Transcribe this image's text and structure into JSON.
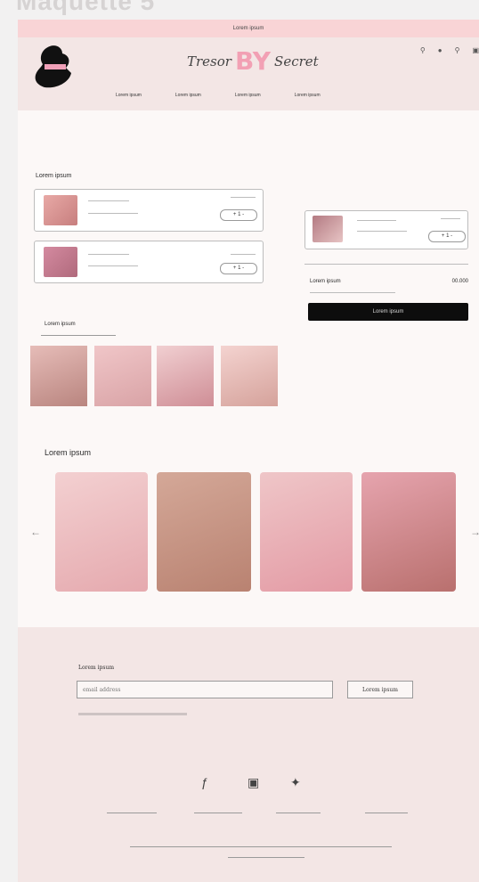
{
  "frame_title": "Maquette 5",
  "topbar": {
    "text": "Lorem ipsum"
  },
  "header": {
    "brand_left": "Tresor",
    "brand_mid": "BY",
    "brand_right": "Secret",
    "nav": [
      "Lorem ipsum",
      "Lorem ipsum",
      "Lorem ipsum",
      "Lorem ipsum"
    ]
  },
  "cart": {
    "title": "Lorem ipsum",
    "items": [
      {
        "qty": "+ 1 -"
      },
      {
        "qty": "+ 1 -"
      }
    ]
  },
  "summary": {
    "item_qty": "+ 1 -",
    "label": "Lorem ipsum",
    "total": "00.000",
    "checkout_label": "Lorem ipsum"
  },
  "related": {
    "label": "Lorem ipsum"
  },
  "products": {
    "title": "Lorem ipsum"
  },
  "footer": {
    "newsletter_label": "Lorem ipsum",
    "email_placeholder": "email address",
    "submit_label": "Lorem ipsum"
  },
  "colors": {
    "topbar": "#f9d4d6",
    "header": "#f3e6e5",
    "brand_pink": "#f2a0b4",
    "checkout": "#0d0d0d"
  },
  "icons": [
    "location-icon",
    "user-icon",
    "search-icon",
    "bag-icon",
    "facebook-icon",
    "instagram-icon",
    "twitter-icon",
    "arrow-left-icon",
    "arrow-right-icon"
  ]
}
